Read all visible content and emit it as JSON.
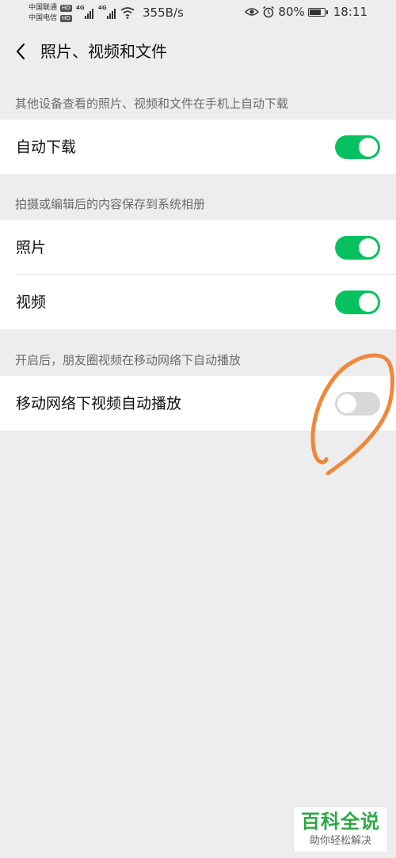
{
  "status_bar": {
    "carrier_1": "中国联通",
    "carrier_2": "中国电信",
    "hd_label": "HD",
    "signal_1_tag": "4G",
    "signal_2_tag": "4G",
    "net_speed": "355B/s",
    "battery_percent": "80%",
    "battery_level": 0.8,
    "time": "18:11",
    "icons": [
      "eye-icon",
      "alarm-icon",
      "battery-icon",
      "wifi-icon",
      "signal-icon"
    ]
  },
  "nav": {
    "title": "照片、视频和文件",
    "back_icon": "chevron-left-icon"
  },
  "sections": [
    {
      "caption": "其他设备查看的照片、视频和文件在手机上自动下载",
      "rows": [
        {
          "label": "自动下载",
          "enabled": true
        }
      ]
    },
    {
      "caption": "拍摄或编辑后的内容保存到系统相册",
      "rows": [
        {
          "label": "照片",
          "enabled": true
        },
        {
          "label": "视频",
          "enabled": true
        }
      ]
    },
    {
      "caption": "开启后，朋友圈视频在移动网络下自动播放",
      "rows": [
        {
          "label": "移动网络下视频自动播放",
          "enabled": false
        }
      ]
    }
  ],
  "colors": {
    "toggle_on": "#07c160",
    "toggle_off": "#d8d8d8",
    "background": "#ededed",
    "annotation": "#f0873a"
  },
  "watermark": {
    "title": "百科全说",
    "subtitle": "助你轻松解决"
  }
}
